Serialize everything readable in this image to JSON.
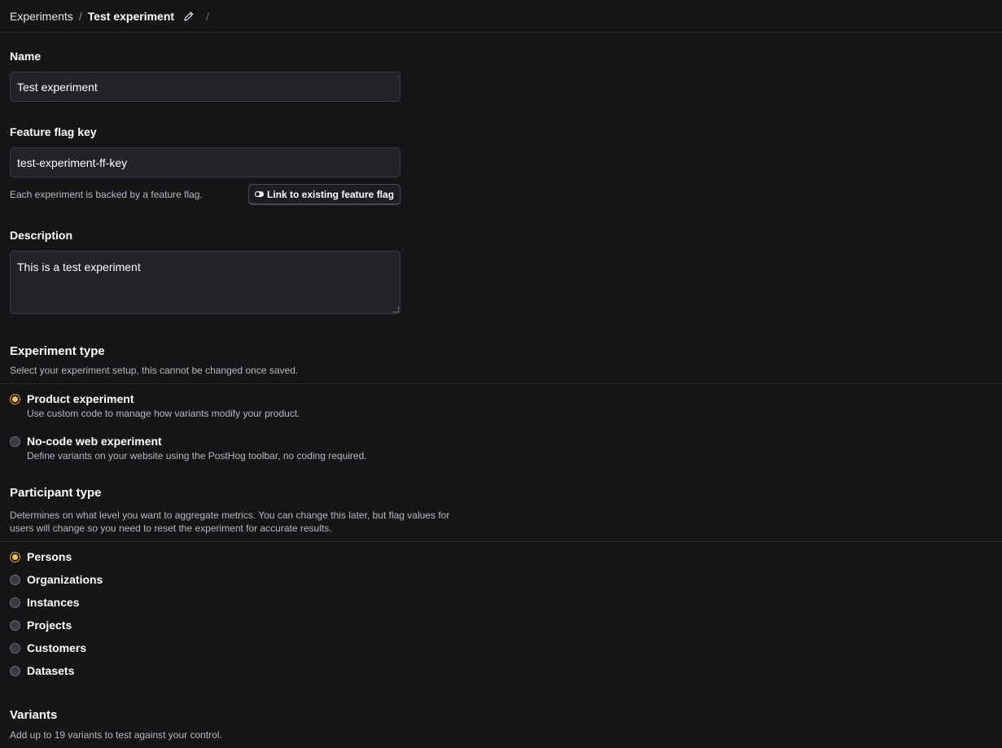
{
  "breadcrumb": {
    "root": "Experiments",
    "separator": "/",
    "current": "Test experiment",
    "trailing_separator": "/"
  },
  "form": {
    "name": {
      "label": "Name",
      "value": "Test experiment"
    },
    "feature_flag": {
      "label": "Feature flag key",
      "value": "test-experiment-ff-key",
      "helper": "Each experiment is backed by a feature flag.",
      "link_button": "Link to existing feature flag"
    },
    "description": {
      "label": "Description",
      "value": "This is a test experiment"
    }
  },
  "experiment_type": {
    "title": "Experiment type",
    "description": "Select your experiment setup, this cannot be changed once saved.",
    "options": [
      {
        "label": "Product experiment",
        "description": "Use custom code to manage how variants modify your product.",
        "selected": true
      },
      {
        "label": "No-code web experiment",
        "description": "Define variants on your website using the PostHog toolbar, no coding required.",
        "selected": false
      }
    ]
  },
  "participant_type": {
    "title": "Participant type",
    "description_line1": "Determines on what level you want to aggregate metrics. You can change this later, but flag values for",
    "description_line2": "users will change so you need to reset the experiment for accurate results.",
    "options": [
      {
        "label": "Persons",
        "selected": true
      },
      {
        "label": "Organizations",
        "selected": false
      },
      {
        "label": "Instances",
        "selected": false
      },
      {
        "label": "Projects",
        "selected": false
      },
      {
        "label": "Customers",
        "selected": false
      },
      {
        "label": "Datasets",
        "selected": false
      }
    ]
  },
  "variants": {
    "title": "Variants",
    "description": "Add up to 19 variants to test against your control."
  },
  "colors": {
    "background": "#151518",
    "input_bg": "#222327",
    "accent": "#f5c748"
  },
  "icons": {
    "edit": "pencil-icon",
    "toggle": "toggle-icon"
  }
}
